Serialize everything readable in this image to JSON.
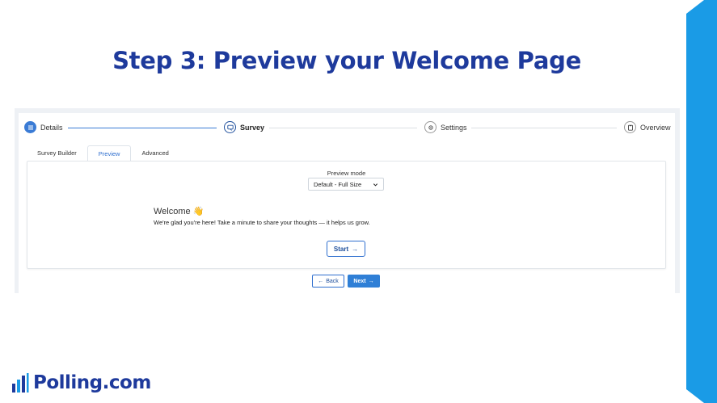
{
  "slide": {
    "title": "Step 3: Preview your Welcome Page"
  },
  "stepper": {
    "steps": [
      {
        "label": "Details",
        "state": "done",
        "icon": "list-icon"
      },
      {
        "label": "Survey",
        "state": "active",
        "icon": "survey-icon"
      },
      {
        "label": "Settings",
        "state": "pending",
        "icon": "gear-icon"
      },
      {
        "label": "Overview",
        "state": "pending",
        "icon": "clipboard-icon"
      }
    ]
  },
  "tabs": [
    {
      "label": "Survey Builder",
      "active": false
    },
    {
      "label": "Preview",
      "active": true
    },
    {
      "label": "Advanced",
      "active": false
    }
  ],
  "preview": {
    "mode_label": "Preview mode",
    "mode_value": "Default - Full Size",
    "welcome_title": "Welcome 👋",
    "welcome_text": "We're glad you're here! Take a minute to share your thoughts — it helps us grow.",
    "start_label": "Start"
  },
  "footer": {
    "back_label": "Back",
    "next_label": "Next"
  },
  "brand": {
    "name": "Polling.com",
    "color": "#1e3a9c",
    "accent": "#1a9be6"
  }
}
